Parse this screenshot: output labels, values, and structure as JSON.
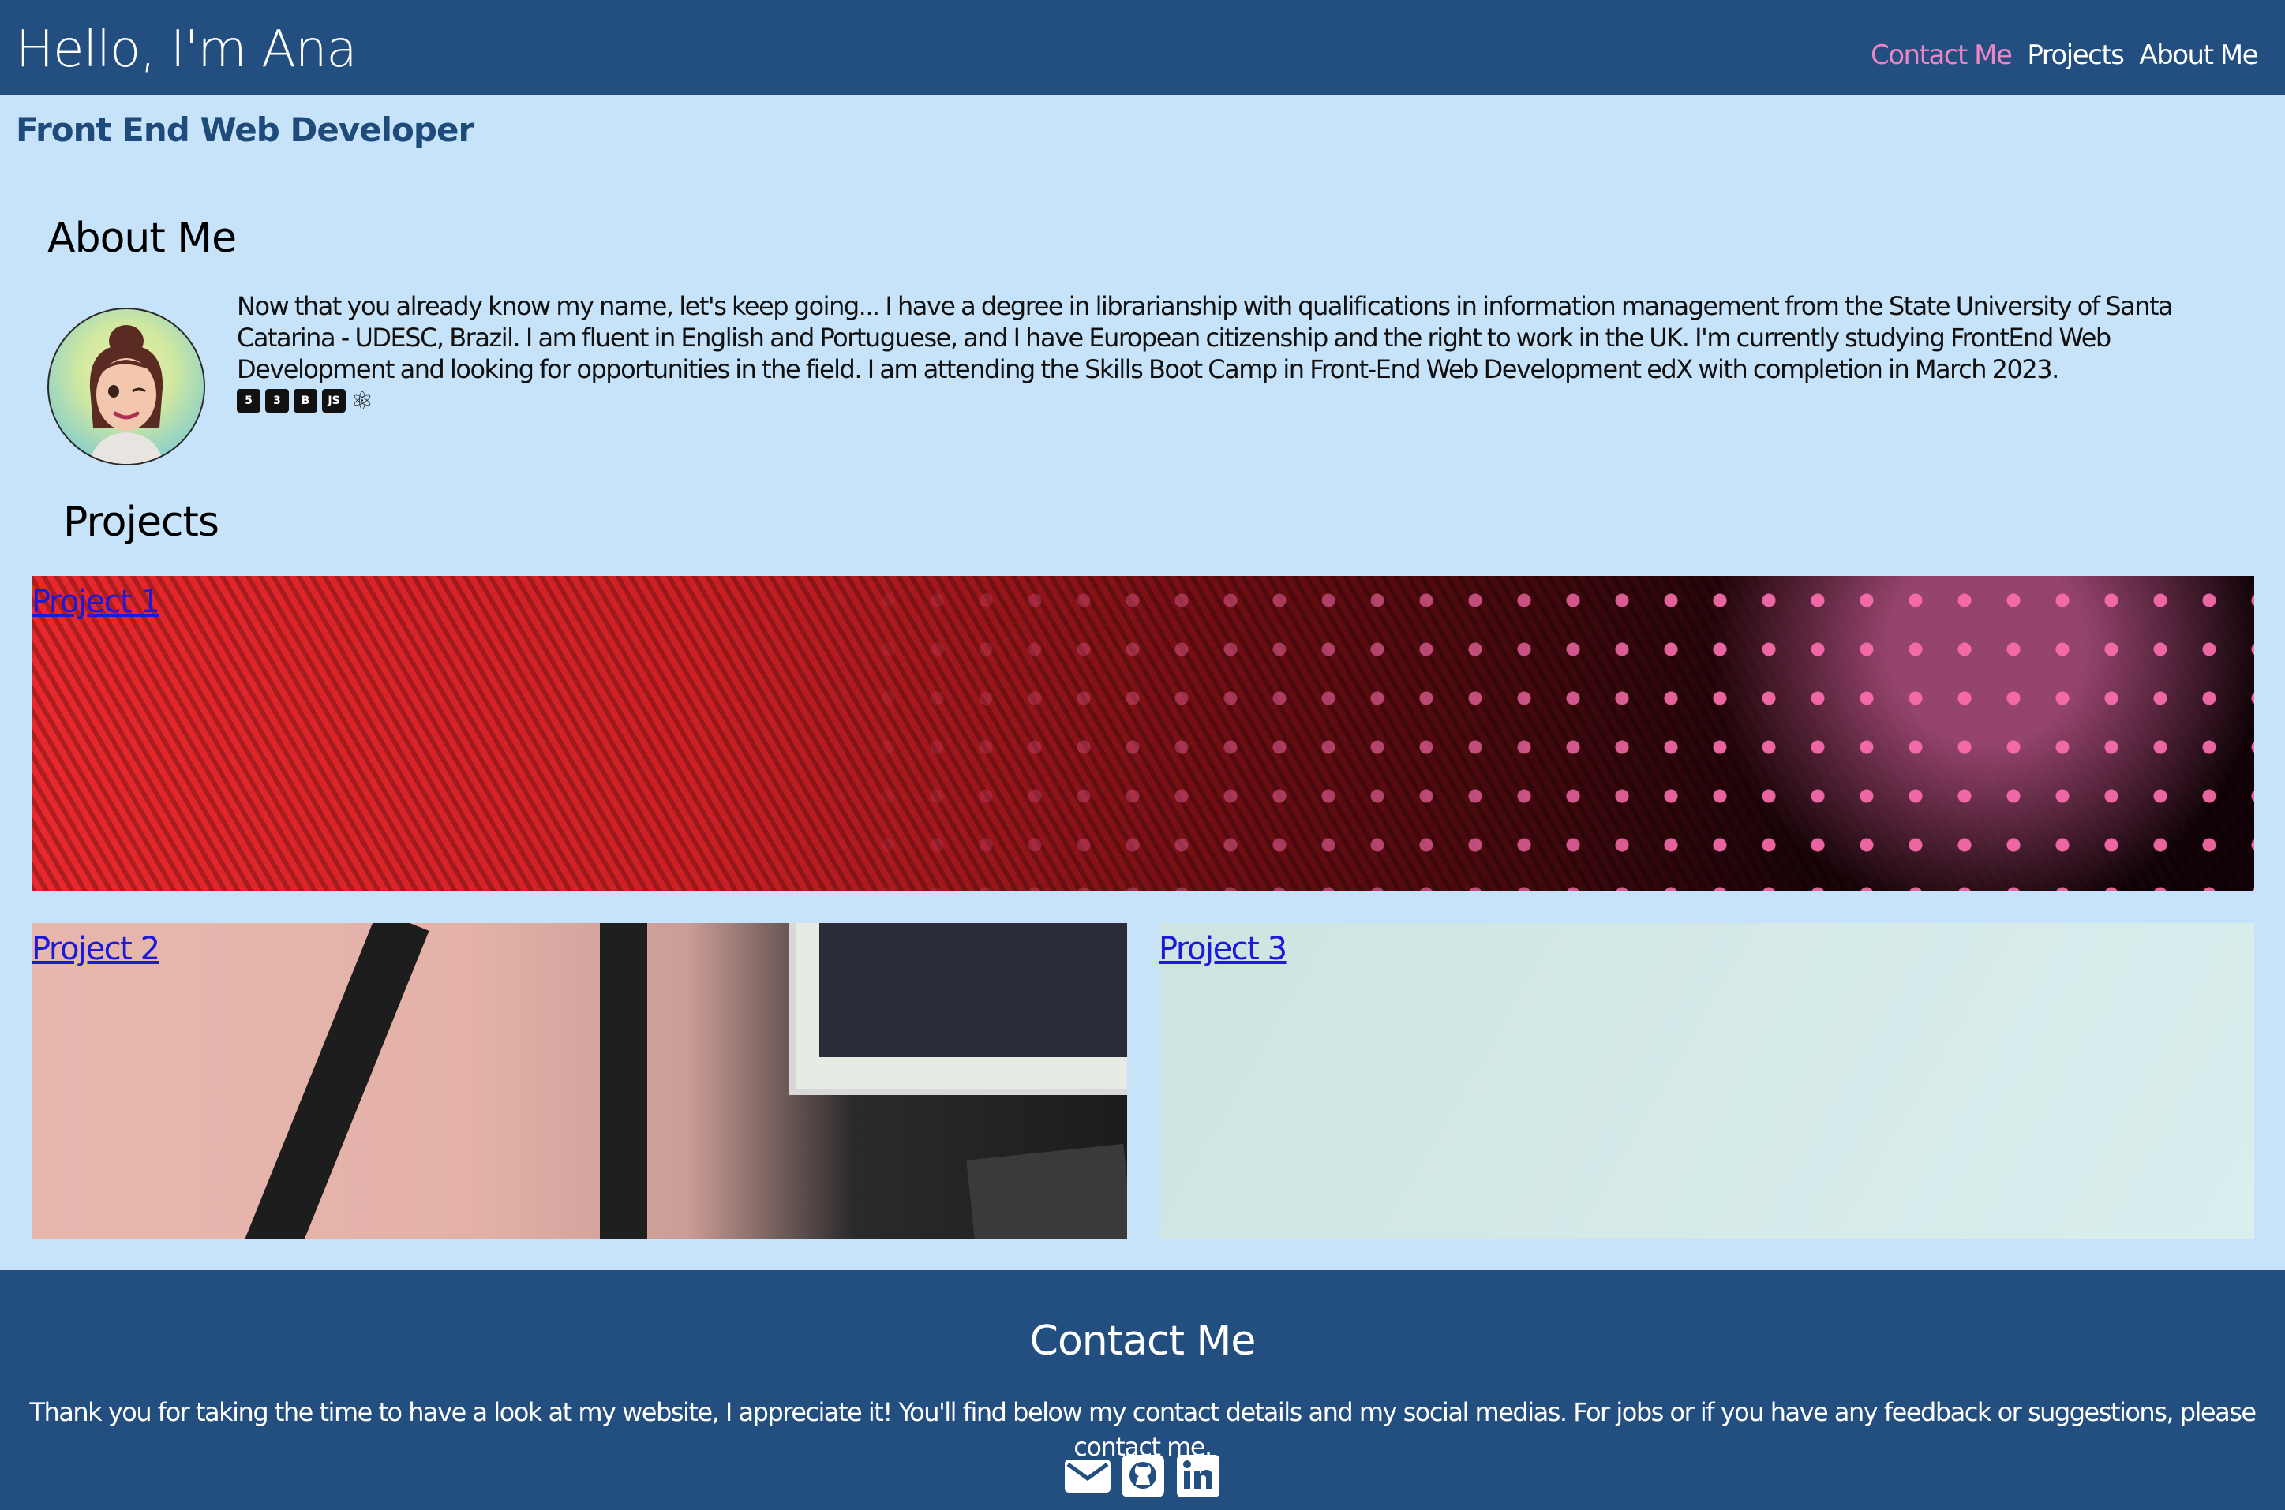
{
  "header": {
    "title": "Hello, I'm Ana",
    "nav": [
      {
        "label": "Contact Me",
        "active": true
      },
      {
        "label": "Projects",
        "active": false
      },
      {
        "label": "About Me",
        "active": false
      }
    ]
  },
  "subtitle": "Front End Web Developer",
  "about": {
    "heading": "About Me",
    "text": "Now that you already know my name, let's keep going... I have a degree in librarianship with qualifications in information management from the State University of Santa Catarina - UDESC, Brazil. I am fluent in English and Portuguese, and I have European citizenship and the right to work in the UK. I'm currently studying FrontEnd Web Development and looking for opportunities in the field. I am attending the Skills Boot Camp in Front-End Web Development edX with completion in March 2023.",
    "tech_icons": [
      "html5-icon",
      "css3-icon",
      "bootstrap-icon",
      "javascript-icon",
      "react-icon"
    ],
    "tech_labels": {
      "html5": "5",
      "css3": "3",
      "bootstrap": "B",
      "javascript": "JS",
      "react": "⚛"
    }
  },
  "projects": {
    "heading": "Projects",
    "items": [
      {
        "label": "Project 1"
      },
      {
        "label": "Project 2"
      },
      {
        "label": "Project 3"
      }
    ]
  },
  "footer": {
    "heading": "Contact Me",
    "text": "Thank you for taking the time to have a look at my website, I appreciate it! You'll find below my contact details and my social medias. For jobs or if you have any feedback or suggestions, please contact me.",
    "social_icons": [
      "email-icon",
      "github-icon",
      "linkedin-icon"
    ]
  },
  "colors": {
    "header_bg": "#224e80",
    "page_bg": "#c7e3fa",
    "nav_active": "#ef86c4",
    "link": "#1a1ad8"
  }
}
